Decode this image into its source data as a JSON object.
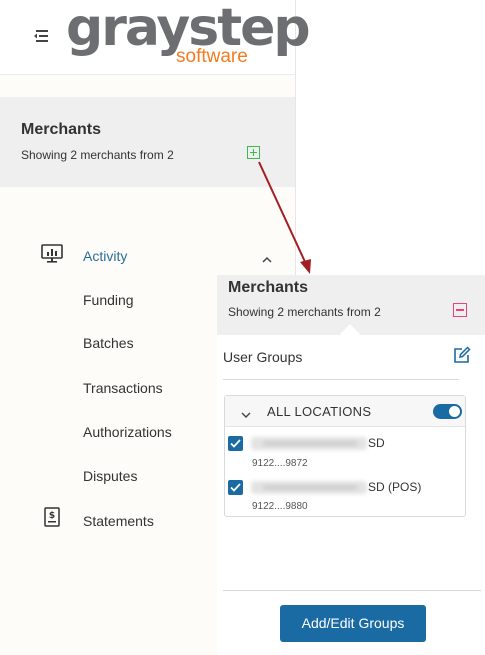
{
  "header": {
    "menu_icon": "menu-collapse-icon",
    "logo_main": "graystep",
    "logo_sub": "software"
  },
  "sidebar": {
    "merchants_title": "Merchants",
    "merchants_subtitle": "Showing 2 merchants from 2",
    "add_icon": "plus-square-icon",
    "nav": {
      "activity": {
        "label": "Activity",
        "icon": "monitor-chart-icon",
        "expanded": true
      },
      "funding": "Funding",
      "batches": "Batches",
      "transactions": "Transactions",
      "authorizations": "Authorizations",
      "disputes": "Disputes",
      "statements": {
        "label": "Statements",
        "icon": "dollar-document-icon"
      }
    }
  },
  "popup": {
    "title": "Merchants",
    "subtitle": "Showing 2 merchants from 2",
    "close_icon": "minus-square-icon",
    "user_groups_label": "User Groups",
    "edit_icon": "edit-icon",
    "locations": {
      "header": "ALL LOCATIONS",
      "toggle_on": true,
      "items": [
        {
          "name_suffix": "SD",
          "id": "9122....9872",
          "checked": true
        },
        {
          "name_suffix": "SD (POS)",
          "id": "9122....9880",
          "checked": true
        }
      ]
    },
    "button_label": "Add/Edit Groups"
  },
  "colors": {
    "accent_blue": "#1a6aa3",
    "active_nav": "#2a6f9b",
    "plus_green": "#3dba4e",
    "minus_pink": "#e8437a",
    "arrow_red": "#a31e22",
    "logo_gray": "#6d6e71",
    "logo_orange": "#f47b20"
  }
}
